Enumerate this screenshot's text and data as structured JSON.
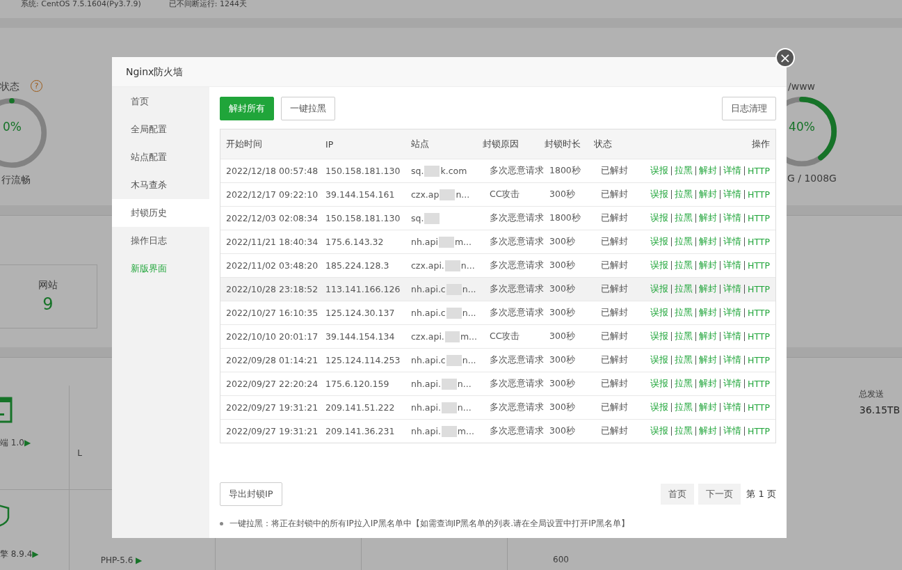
{
  "background": {
    "top_bar": [
      "系统: CentOS 7.5.1604(Py3.7.9)",
      "已不间断运行: 1244天"
    ],
    "status_gauge": {
      "label": "状态",
      "help": "?",
      "value": "0%",
      "caption": "行流畅",
      "level": 0
    },
    "disk_gauge": {
      "label": "/www",
      "value": "40%",
      "caption": "G / 1008G",
      "level": 0.4
    },
    "site_card": {
      "label": "网站",
      "value": "9"
    },
    "software": [
      {
        "name": "端 1.0",
        "arrow": "▶"
      },
      {
        "name": "L"
      },
      {
        "name": "擎 8.9.4",
        "arrow": "▶"
      },
      {
        "name": "PHP-5.6",
        "arrow": "▶"
      }
    ],
    "traffic": {
      "label": "总发送",
      "value": "36.15TB"
    },
    "chart_tick": "600"
  },
  "dialog": {
    "title": "Nginx防火墙",
    "close": "×",
    "sidebar": [
      {
        "label": "首页",
        "selected": false,
        "kind": "menu"
      },
      {
        "label": "全局配置",
        "selected": false,
        "kind": "menu"
      },
      {
        "label": "站点配置",
        "selected": false,
        "kind": "menu"
      },
      {
        "label": "木马查杀",
        "selected": false,
        "kind": "menu"
      },
      {
        "label": "封锁历史",
        "selected": true,
        "kind": "menu"
      },
      {
        "label": "操作日志",
        "selected": false,
        "kind": "menu"
      },
      {
        "label": "新版界面",
        "selected": false,
        "kind": "link"
      }
    ],
    "toolbar": {
      "primary": "解封所有",
      "secondary": "一键拉黑",
      "right": "日志清理"
    },
    "table": {
      "columns": [
        "开始时间",
        "IP",
        "站点",
        "封锁原因",
        "封锁时长",
        "状态",
        "操作"
      ],
      "rows": [
        {
          "time": "2022/12/18 00:57:48",
          "ip": "150.158.181.130",
          "site_start": "sq.",
          "site_end": "k.com",
          "reason": "多次恶意请求",
          "duration": "1800秒",
          "status": "已解封",
          "hovered": false,
          "actions": [
            "误报",
            "拉黑",
            "解封",
            "详情",
            "HTTP"
          ]
        },
        {
          "time": "2022/12/17 09:22:10",
          "ip": "39.144.154.161",
          "site_start": "czx.ap",
          "site_end": "n...",
          "reason": "CC攻击",
          "duration": "300秒",
          "status": "已解封",
          "hovered": false,
          "actions": [
            "误报",
            "拉黑",
            "解封",
            "详情",
            "HTTP"
          ]
        },
        {
          "time": "2022/12/03 02:08:34",
          "ip": "150.158.181.130",
          "site_start": "sq.",
          "reason": "多次恶意请求",
          "duration": "1800秒",
          "status": "已解封",
          "hovered": false,
          "actions": [
            "误报",
            "拉黑",
            "解封",
            "详情",
            "HTTP"
          ]
        },
        {
          "time": "2022/11/21 18:40:34",
          "ip": "175.6.143.32",
          "site_start": "nh.api",
          "site_end": "m...",
          "reason": "多次恶意请求",
          "duration": "300秒",
          "status": "已解封",
          "hovered": false,
          "actions": [
            "误报",
            "拉黑",
            "解封",
            "详情",
            "HTTP"
          ]
        },
        {
          "time": "2022/11/02 03:48:20",
          "ip": "185.224.128.3",
          "site_start": "czx.api.",
          "site_end": "n...",
          "reason": "多次恶意请求",
          "duration": "300秒",
          "status": "已解封",
          "hovered": false,
          "actions": [
            "误报",
            "拉黑",
            "解封",
            "详情",
            "HTTP"
          ]
        },
        {
          "time": "2022/10/28 23:18:52",
          "ip": "113.141.166.126",
          "site_start": "nh.api.c",
          "site_end": "n...",
          "reason": "多次恶意请求",
          "duration": "300秒",
          "status": "已解封",
          "hovered": true,
          "actions": [
            "误报",
            "拉黑",
            "解封",
            "详情",
            "HTTP"
          ]
        },
        {
          "time": "2022/10/27 16:10:35",
          "ip": "125.124.30.137",
          "site_start": "nh.api.c",
          "site_end": "n...",
          "reason": "多次恶意请求",
          "duration": "300秒",
          "status": "已解封",
          "hovered": false,
          "actions": [
            "误报",
            "拉黑",
            "解封",
            "详情",
            "HTTP"
          ]
        },
        {
          "time": "2022/10/10 20:01:17",
          "ip": "39.144.154.134",
          "site_start": "czx.api.",
          "site_end": "m...",
          "reason": "CC攻击",
          "duration": "300秒",
          "status": "已解封",
          "hovered": false,
          "actions": [
            "误报",
            "拉黑",
            "解封",
            "详情",
            "HTTP"
          ]
        },
        {
          "time": "2022/09/28 01:14:21",
          "ip": "125.124.114.253",
          "site_start": "nh.api.c",
          "site_end": "n...",
          "reason": "多次恶意请求",
          "duration": "300秒",
          "status": "已解封",
          "hovered": false,
          "actions": [
            "误报",
            "拉黑",
            "解封",
            "详情",
            "HTTP"
          ]
        },
        {
          "time": "2022/09/27 22:20:24",
          "ip": "175.6.120.159",
          "site_start": "nh.api.",
          "site_end": "n...",
          "reason": "多次恶意请求",
          "duration": "300秒",
          "status": "已解封",
          "hovered": false,
          "actions": [
            "误报",
            "拉黑",
            "解封",
            "详情",
            "HTTP"
          ]
        },
        {
          "time": "2022/09/27 19:31:21",
          "ip": "209.141.51.222",
          "site_start": "nh.api.",
          "site_end": "n...",
          "reason": "多次恶意请求",
          "duration": "300秒",
          "status": "已解封",
          "hovered": false,
          "actions": [
            "误报",
            "拉黑",
            "解封",
            "详情",
            "HTTP"
          ]
        },
        {
          "time": "2022/09/27 19:31:21",
          "ip": "209.141.36.231",
          "site_start": "nh.api.",
          "site_end": "m...",
          "reason": "多次恶意请求",
          "duration": "300秒",
          "status": "已解封",
          "hovered": false,
          "actions": [
            "误报",
            "拉黑",
            "解封",
            "详情",
            "HTTP"
          ]
        }
      ]
    },
    "export": "导出封锁IP",
    "pagination": {
      "first": "首页",
      "next": "下一页",
      "current": "第 1 页"
    },
    "note": "一键拉黑：将正在封锁中的所有IP拉入IP黑名单中【如需查询IP黑名单的列表.请在全局设置中打开IP黑名单】"
  }
}
